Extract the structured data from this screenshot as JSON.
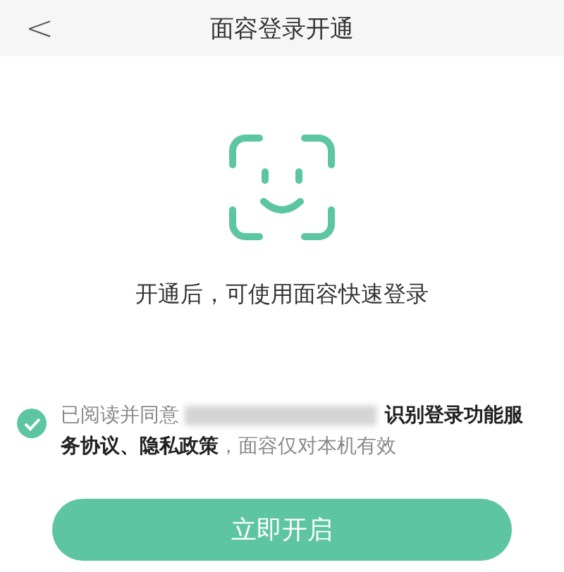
{
  "header": {
    "back": "<",
    "title": "面容登录开通"
  },
  "hint": "开通后，可使用面容快速登录",
  "agreement": {
    "checked": true,
    "prefix": "已阅读并同意",
    "lines": [
      "**识别登录功能服**",
      "**务协议、隐私政策**，面容仅对本机有效"
    ]
  },
  "button": "立即开启"
}
